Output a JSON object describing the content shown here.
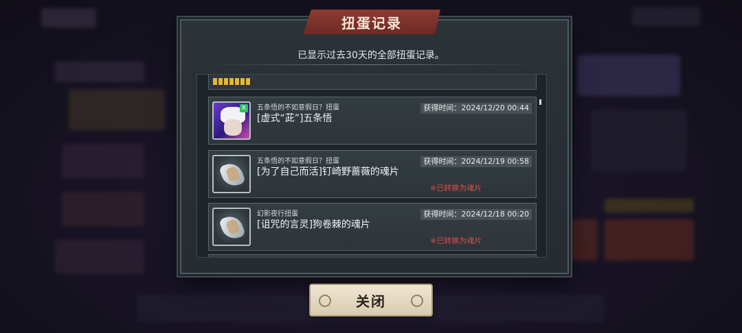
{
  "dialog": {
    "title": "扭蛋记录",
    "subtitle": "已显示过去30天的全部扭蛋记录。",
    "close_label": "关闭"
  },
  "records": [
    {
      "source": "五条悟的不如意假日？扭蛋",
      "name": "[虚式“茈”]五条悟",
      "time": "获得时间：2024/12/20 00:44",
      "converted": "",
      "icon": "character-portrait-icon"
    },
    {
      "source": "五条悟的不如意假日？扭蛋",
      "name": "[为了自己而活]钉崎野蔷薇的魂片",
      "time": "获得时间：2024/12/19 00:58",
      "converted": "※已转换为魂片",
      "icon": "soul-fragment-icon"
    },
    {
      "source": "幻影夜行扭蛋",
      "name": "[诅咒的言灵]狗卷棘的魂片",
      "time": "获得时间：2024/12/18 00:20",
      "converted": "※已转换为魂片",
      "icon": "soul-fragment-icon"
    }
  ],
  "colors": {
    "banner": "#8e3b33",
    "converted_text": "#e24b4b",
    "panel": "#2b3238"
  }
}
